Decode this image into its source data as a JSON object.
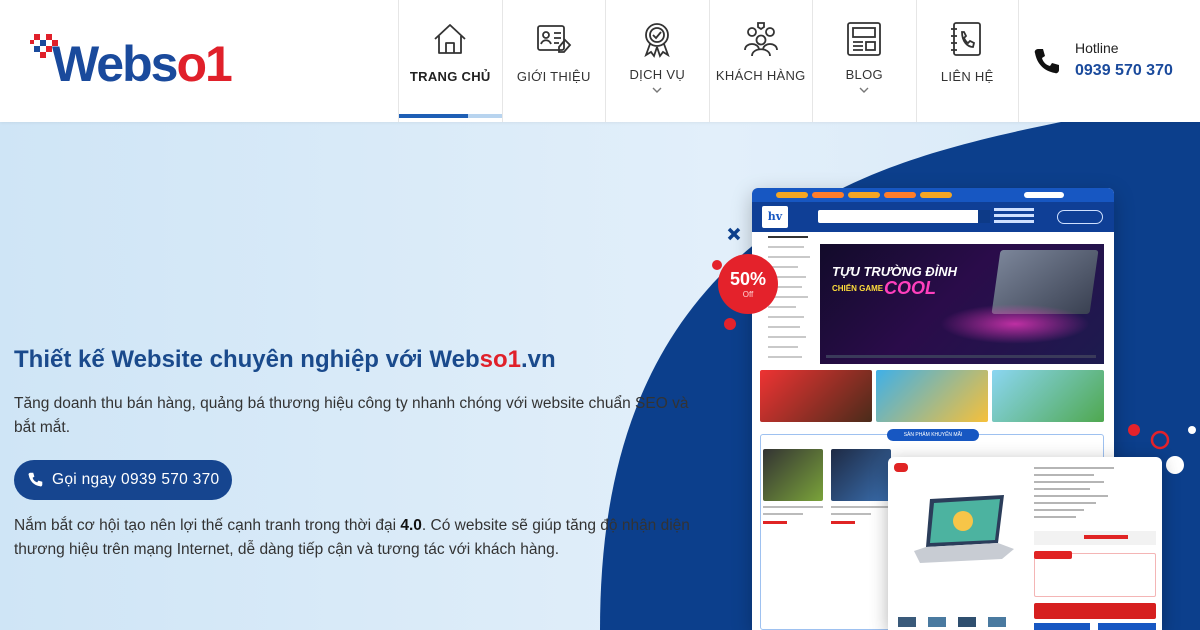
{
  "header": {
    "logo": {
      "text_main": "Webs",
      "text_o": "o",
      "text_one": "1"
    },
    "nav": [
      {
        "label": "TRANG CHỦ",
        "icon": "home-icon",
        "active": true,
        "dropdown": false
      },
      {
        "label": "GIỚI THIỆU",
        "icon": "about-card-icon",
        "active": false,
        "dropdown": false
      },
      {
        "label": "DỊCH VỤ",
        "icon": "service-badge-icon",
        "active": false,
        "dropdown": true
      },
      {
        "label": "KHÁCH HÀNG",
        "icon": "customers-icon",
        "active": false,
        "dropdown": false
      },
      {
        "label": "BLOG",
        "icon": "blog-icon",
        "active": false,
        "dropdown": true
      },
      {
        "label": "LIÊN HỆ",
        "icon": "contact-book-icon",
        "active": false,
        "dropdown": false
      }
    ],
    "hotline": {
      "caption": "Hotline",
      "number": "0939 570 370",
      "icon": "phone-icon"
    }
  },
  "hero": {
    "headline_prefix": "Thiết kế Website chuyên nghiệp với Web",
    "headline_red": "so1",
    "headline_suffix": ".vn",
    "description": "Tăng doanh thu bán hàng, quảng bá thương hiệu công ty nhanh chóng với website chuẩn SEO và bắt mắt.",
    "cta_label": "Gọi ngay 0939 570 370",
    "body_prefix": "Nắm bắt cơ hội tạo nên lợi thế cạnh tranh trong thời đại ",
    "body_bold": "4.0",
    "body_suffix": ". Có website sẽ giúp tăng độ nhận diện thương hiệu trên mạng Internet, dễ dàng tiếp cận và tương tác với khách hàng."
  },
  "mockup": {
    "badge_percent": "50%",
    "badge_off": "Off",
    "logo_text": "hv",
    "banner_line1": "TỰU TRƯỜNG ĐỈNH",
    "banner_line2": "CHIẾN GAME",
    "banner_cool": "COOL",
    "section_title": "SẢN PHẨM KHUYẾN MÃI"
  },
  "colors": {
    "brand_blue": "#1a4a9c",
    "brand_red": "#e0202a",
    "hero_light": "#dcebf7",
    "hero_dark": "#0c3f8c",
    "cta": "#16458f"
  }
}
